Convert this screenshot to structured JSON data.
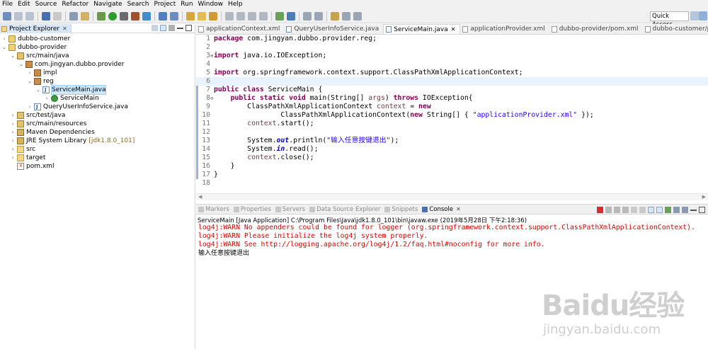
{
  "menu": [
    "File",
    "Edit",
    "Source",
    "Refactor",
    "Navigate",
    "Search",
    "Project",
    "Run",
    "Window",
    "Help"
  ],
  "toolbar": {
    "quick_access": "Quick Access"
  },
  "explorer": {
    "title": "Project Explorer",
    "items": [
      {
        "label": "dubbo-customer",
        "icon": "project-icon",
        "expanded": false
      },
      {
        "label": "dubbo-provider",
        "icon": "project-icon",
        "expanded": true
      },
      {
        "label": "src/main/java",
        "icon": "source-folder-icon",
        "expanded": true
      },
      {
        "label": "com.jingyan.dubbo.provider",
        "icon": "package-icon",
        "expanded": true
      },
      {
        "label": "impl",
        "icon": "package-icon",
        "expanded": false
      },
      {
        "label": "reg",
        "icon": "package-icon",
        "expanded": true
      },
      {
        "label": "ServiceMain.java",
        "icon": "java-file-icon",
        "expanded": true,
        "selected": true
      },
      {
        "label": "ServiceMain",
        "icon": "class-icon",
        "expanded": false
      },
      {
        "label": "QueryUserInfoService.java",
        "icon": "java-file-icon",
        "expanded": false
      },
      {
        "label": "src/test/java",
        "icon": "source-folder-icon",
        "expanded": false
      },
      {
        "label": "src/main/resources",
        "icon": "source-folder-icon",
        "expanded": false
      },
      {
        "label": "Maven Dependencies",
        "icon": "library-icon",
        "expanded": false
      },
      {
        "label": "JRE System Library",
        "suffix": "[jdk1.8.0_101]",
        "icon": "library-icon",
        "expanded": false
      },
      {
        "label": "src",
        "icon": "folder-icon",
        "expanded": false
      },
      {
        "label": "target",
        "icon": "folder-icon",
        "expanded": false
      },
      {
        "label": "pom.xml",
        "icon": "xml-file-icon",
        "expanded": false
      }
    ]
  },
  "editor": {
    "tabs": [
      {
        "label": "applicationContext.xml",
        "active": false
      },
      {
        "label": "QueryUserInfoService.java",
        "active": false
      },
      {
        "label": "ServiceMain.java",
        "active": true
      },
      {
        "label": "applicationProvider.xml",
        "active": false
      },
      {
        "label": "dubbo-provider/pom.xml",
        "active": false
      },
      {
        "label": "dubbo-customer/pom.xml",
        "active": false
      }
    ],
    "lines": [
      {
        "n": "1",
        "text": "package com.jingyan.dubbo.provider.reg;"
      },
      {
        "n": "2",
        "text": ""
      },
      {
        "n": "3",
        "text": "import java.io.IOException;"
      },
      {
        "n": "4",
        "text": ""
      },
      {
        "n": "5",
        "text": "import org.springframework.context.support.ClassPathXmlApplicationContext;"
      },
      {
        "n": "6",
        "text": ""
      },
      {
        "n": "7",
        "text": "public class ServiceMain {"
      },
      {
        "n": "8",
        "text": "    public static void main(String[] args) throws IOException{"
      },
      {
        "n": "9",
        "text": "        ClassPathXmlApplicationContext context = new"
      },
      {
        "n": "10",
        "text": "                ClassPathXmlApplicationContext(new String[] { \"applicationProvider.xml\" });"
      },
      {
        "n": "11",
        "text": "        context.start();"
      },
      {
        "n": "12",
        "text": ""
      },
      {
        "n": "13",
        "text": "        System.out.println(\"输入任意按键退出\");"
      },
      {
        "n": "14",
        "text": "        System.in.read();"
      },
      {
        "n": "15",
        "text": "        context.close();"
      },
      {
        "n": "16",
        "text": "    }"
      },
      {
        "n": "17",
        "text": "}"
      },
      {
        "n": "18",
        "text": ""
      }
    ]
  },
  "bottom_tabs": [
    {
      "label": "Markers",
      "active": false
    },
    {
      "label": "Properties",
      "active": false
    },
    {
      "label": "Servers",
      "active": false
    },
    {
      "label": "Data Source Explorer",
      "active": false
    },
    {
      "label": "Snippets",
      "active": false
    },
    {
      "label": "Console",
      "active": true
    }
  ],
  "console": {
    "title": "ServiceMain [Java Application] C:\\Program Files\\Java\\jdk1.8.0_101\\bin\\javaw.exe (2019年5月28日 下午2:18:36)",
    "lines": [
      {
        "text": "log4j:WARN No appenders could be found for logger (org.springframework.context.support.ClassPathXmlApplicationContext).",
        "error": true
      },
      {
        "text": "log4j:WARN Please initialize the log4j system properly.",
        "error": true
      },
      {
        "text": "log4j:WARN See http://logging.apache.org/log4j/1.2/faq.html#noconfig for more info.",
        "error": true
      },
      {
        "text": "输入任意按键退出",
        "error": false
      }
    ]
  },
  "watermark": {
    "brand": "Baidu经验",
    "sub": "jingyan.baidu.com"
  },
  "colors": {
    "keyword": "#7f0055",
    "string": "#2a00ff",
    "error": "#e00000",
    "selection": "#cce8ff"
  }
}
